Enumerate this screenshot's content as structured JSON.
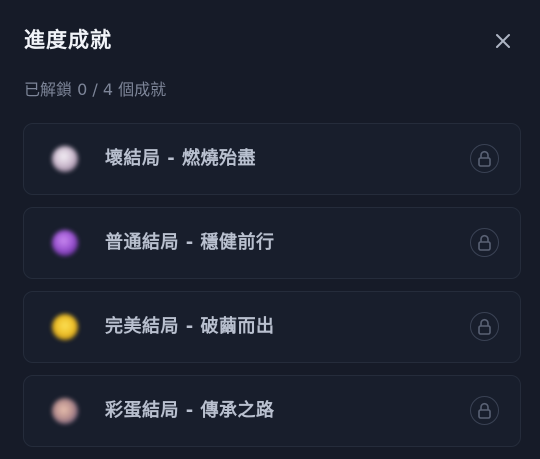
{
  "dialog": {
    "title": "進度成就",
    "subtitle": "已解鎖 0 / 4 個成就",
    "close_icon": "close-icon"
  },
  "achievements": [
    {
      "label": "壞結局 - 燃燒殆盡",
      "icon": "skull-icon",
      "locked": true,
      "lock_icon": "lock-icon",
      "icon_colors": [
        "#e9e4ec",
        "#b8a6bb"
      ]
    },
    {
      "label": "普通結局 - 穩健前行",
      "icon": "purple-orb-icon",
      "locked": true,
      "lock_icon": "lock-icon",
      "icon_colors": [
        "#b46ae0",
        "#7a3bb0"
      ]
    },
    {
      "label": "完美結局 - 破繭而出",
      "icon": "star-icon",
      "locked": true,
      "lock_icon": "lock-icon",
      "icon_colors": [
        "#f3d23a",
        "#d7a11c"
      ]
    },
    {
      "label": "彩蛋結局 - 傳承之路",
      "icon": "scroll-icon",
      "locked": true,
      "lock_icon": "lock-icon",
      "icon_colors": [
        "#e0b2a2",
        "#8f6a7a"
      ]
    }
  ],
  "colors": {
    "background": "#161b28",
    "card": "#181e2c",
    "card_border": "#252c3b",
    "title": "#f1f3f8",
    "subtitle": "#7d8598",
    "label": "#b9c0cf",
    "lock": "#5a6275"
  }
}
